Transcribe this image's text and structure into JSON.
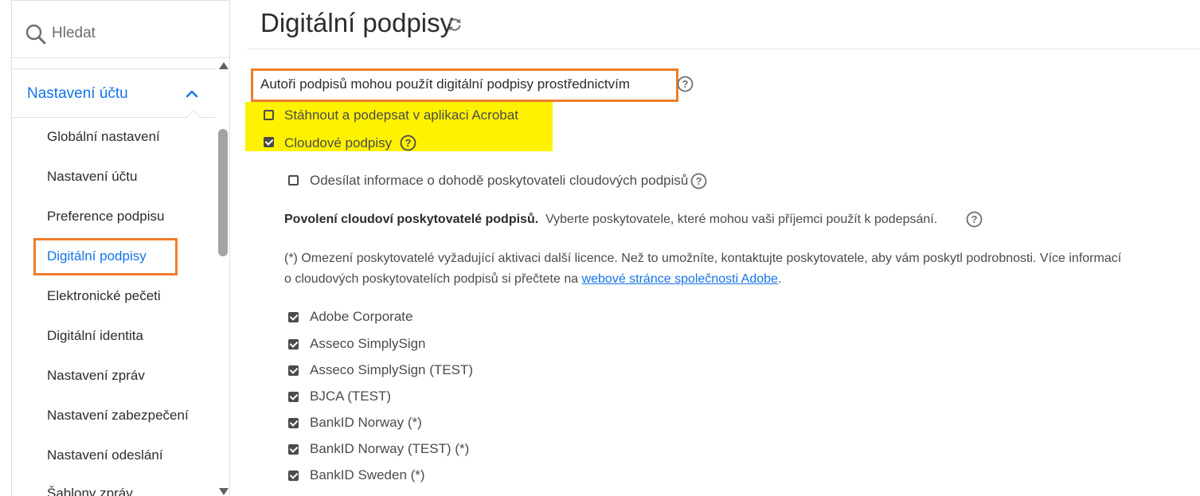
{
  "search": {
    "placeholder": "Hledat"
  },
  "sidebar": {
    "section_label": "Nastavení účtu",
    "items": [
      {
        "label": "Globální nastavení"
      },
      {
        "label": "Nastavení účtu"
      },
      {
        "label": "Preference podpisu"
      },
      {
        "label": "Digitální podpisy"
      },
      {
        "label": "Elektronické pečeti"
      },
      {
        "label": "Digitální identita"
      },
      {
        "label": "Nastavení zpráv"
      },
      {
        "label": "Nastavení zabezpečení"
      },
      {
        "label": "Nastavení odeslání"
      },
      {
        "label": "Šablony zpráv"
      }
    ]
  },
  "main": {
    "title": "Digitální podpisy",
    "heading": "Autoři podpisů mohou použít digitální podpisy prostřednictvím",
    "options": [
      {
        "label": "Stáhnout a podepsat v aplikaci Acrobat",
        "checked": false
      },
      {
        "label": "Cloudové podpisy",
        "checked": true
      }
    ],
    "send_info": {
      "label": "Odesílat informace o dohodě poskytovateli cloudových podpisů",
      "checked": false
    },
    "providers_heading": "Povolení cloudoví poskytovatelé podpisů.",
    "providers_desc": "Vyberte poskytovatele, které mohou vaši příjemci použít k podepsání.",
    "notice_line1": "(*) Omezení poskytovatelé vyžadující aktivaci další licence. Než to umožníte, kontaktujte poskytovatele, aby vám poskytl podrobnosti. Více informací",
    "notice_line2_prefix": "o cloudových poskytovatelích podpisů si přečtete na ",
    "notice_link": "webové stránce společnosti Adobe",
    "notice_suffix": ".",
    "providers": [
      {
        "label": "Adobe Corporate",
        "checked": true
      },
      {
        "label": "Asseco SimplySign",
        "checked": true
      },
      {
        "label": "Asseco SimplySign (TEST)",
        "checked": true
      },
      {
        "label": "BJCA (TEST)",
        "checked": true
      },
      {
        "label": "BankID Norway (*)",
        "checked": true
      },
      {
        "label": "BankID Norway (TEST) (*)",
        "checked": true
      },
      {
        "label": "BankID Sweden (*)",
        "checked": true
      }
    ]
  },
  "colors": {
    "accent": "#1473e6",
    "annotation_border": "#ef7d2a",
    "highlight": "#fff200"
  },
  "icons": [
    "search-icon",
    "chevron-up-icon",
    "refresh-icon",
    "help-icon"
  ]
}
